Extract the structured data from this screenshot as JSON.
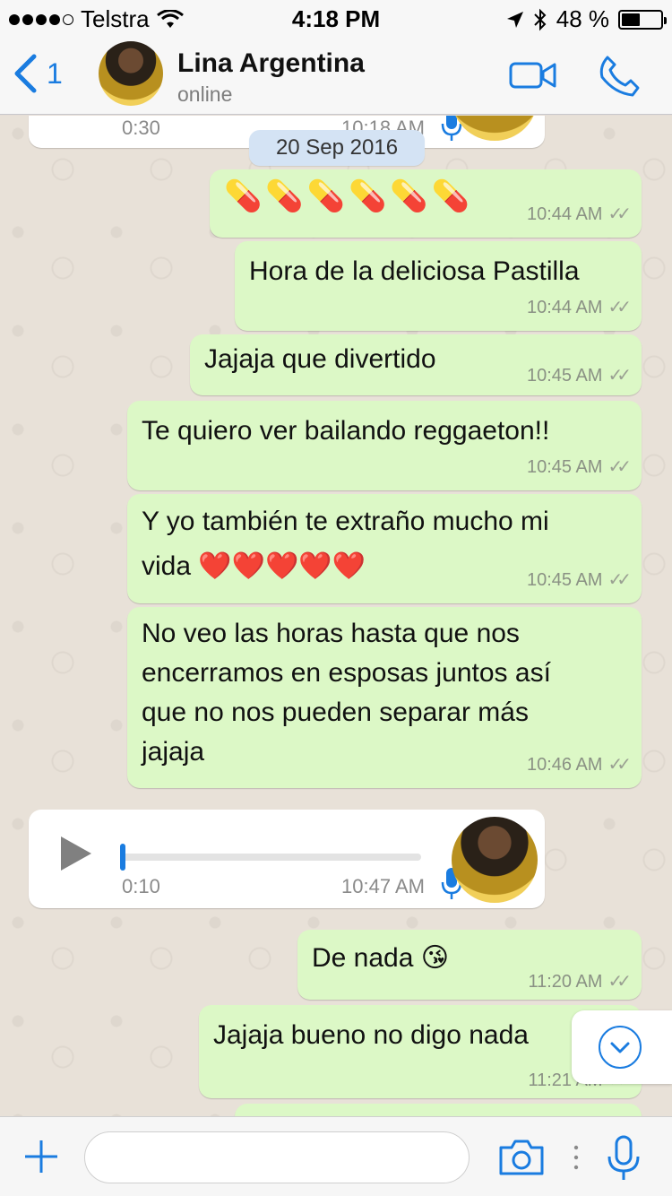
{
  "status_bar": {
    "carrier": "Telstra",
    "time": "4:18 PM",
    "battery": "48 %",
    "battery_level": 0.48
  },
  "header": {
    "back_count": "1",
    "contact_name": "Lina Argentina",
    "contact_status": "online"
  },
  "chat": {
    "partial_top": {
      "duration": "0:30",
      "time": "10:18 AM"
    },
    "date_chip": "20 Sep 2016",
    "messages": [
      {
        "text": "💊💊💊💊💊💊",
        "time": "10:44 AM"
      },
      {
        "text": "Hora de la deliciosa Pastilla",
        "time": "10:44 AM"
      },
      {
        "text": "Jajaja que divertido",
        "time": "10:45 AM"
      },
      {
        "text": "Te quiero ver bailando reggaeton!!",
        "time": "10:45 AM"
      },
      {
        "line1": "Y yo también te extraño mucho mi",
        "line2": "vida ❤️❤️❤️❤️❤️",
        "time": "10:45 AM"
      },
      {
        "line1": "No veo las horas hasta que nos",
        "line2": "encerramos en esposas juntos así",
        "line3": "que no nos pueden separar más",
        "line4": "jajaja",
        "time": "10:46 AM"
      },
      {
        "text": "De nada 😘",
        "time": "11:20 AM"
      },
      {
        "text": "Jajaja bueno no digo nada",
        "time": "11:21 AM"
      }
    ],
    "voice": {
      "duration": "0:10",
      "time": "10:47 AM",
      "progress": 0.0
    }
  },
  "input": {
    "value": "",
    "placeholder": ""
  },
  "colors": {
    "accent": "#1a7ce0",
    "outgoing_bubble": "#dcf8c6",
    "incoming_bubble": "#ffffff",
    "date_chip": "#d4e3f4"
  }
}
